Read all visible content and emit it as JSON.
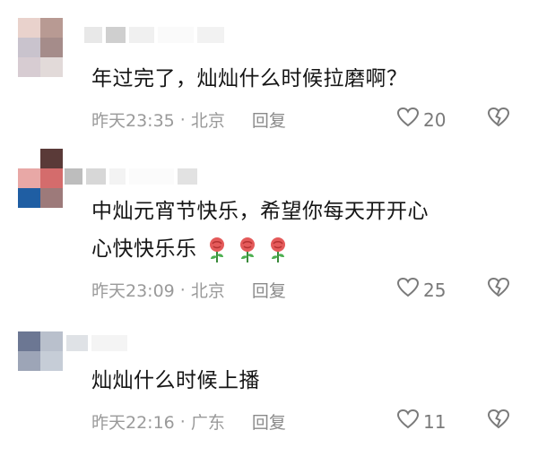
{
  "comments": [
    {
      "text_lines": [
        "年过完了，灿灿什么时候拉磨啊？"
      ],
      "time": "昨天23:35",
      "location": "北京",
      "reply_label": "回复",
      "likes": "20",
      "avatar_colors": [
        "#e9d2cc",
        "#b89a93",
        "#c9c3cd",
        "#a58c8a",
        "#d7ccd2",
        "#e2dad9"
      ]
    },
    {
      "text_lines": [
        "中灿元宵节快乐，希望你每天开开心",
        "心快快乐乐"
      ],
      "time": "昨天23:09",
      "location": "北京",
      "reply_label": "回复",
      "likes": "25",
      "avatar_colors": [
        "#5a3a38",
        "#8d7a78",
        "#c2b2ad",
        "#e8a8a6",
        "#d46c6c",
        "#cfcfcf",
        "#1f5ea3",
        "#9d7a7a",
        "#e3e3e3"
      ]
    },
    {
      "text_lines": [
        "灿灿什么时候上播"
      ],
      "time": "昨天22:16",
      "location": "广东",
      "reply_label": "回复",
      "likes": "11",
      "avatar_colors": [
        "#6c7793",
        "#b9c0cc",
        "#d9d9dd",
        "#9da5b7",
        "#c6cdd7",
        "#e5e7ea"
      ]
    }
  ],
  "separator": "·",
  "icons": {
    "like": "heart-outline-icon",
    "dislike": "broken-heart-icon",
    "rose": "rose-emoji-icon"
  },
  "colors": {
    "meta_text": "#9a9a9a",
    "body_text": "#151515"
  }
}
